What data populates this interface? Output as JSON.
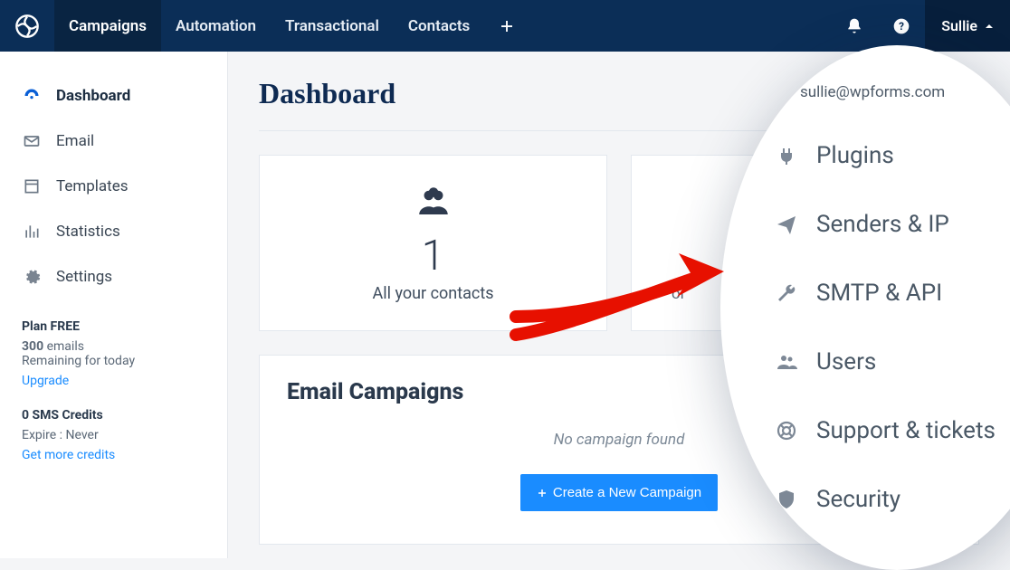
{
  "topnav": {
    "items": [
      "Campaigns",
      "Automation",
      "Transactional",
      "Contacts"
    ],
    "user": "Sullie"
  },
  "sidebar": {
    "items": [
      {
        "label": "Dashboard"
      },
      {
        "label": "Email"
      },
      {
        "label": "Templates"
      },
      {
        "label": "Statistics"
      },
      {
        "label": "Settings"
      }
    ],
    "plan": {
      "title": "Plan FREE",
      "emails_count": "300",
      "emails_label": "emails",
      "remaining": "Remaining for today",
      "upgrade": "Upgrade"
    },
    "sms": {
      "title": "0 SMS Credits",
      "expire": "Expire : Never",
      "more": "Get more credits"
    }
  },
  "main": {
    "title": "Dashboard",
    "card1": {
      "num": "1",
      "txt": "All your contacts"
    },
    "card2": {
      "or": "or"
    },
    "panel": {
      "title": "Email Campaigns",
      "empty": "No campaign found",
      "button": "Create a New Campaign"
    }
  },
  "popup": {
    "email": "sullie@wpforms.com",
    "items": [
      "Plugins",
      "Senders & IP",
      "SMTP & API",
      "Users",
      "Support & tickets",
      "Security"
    ]
  }
}
